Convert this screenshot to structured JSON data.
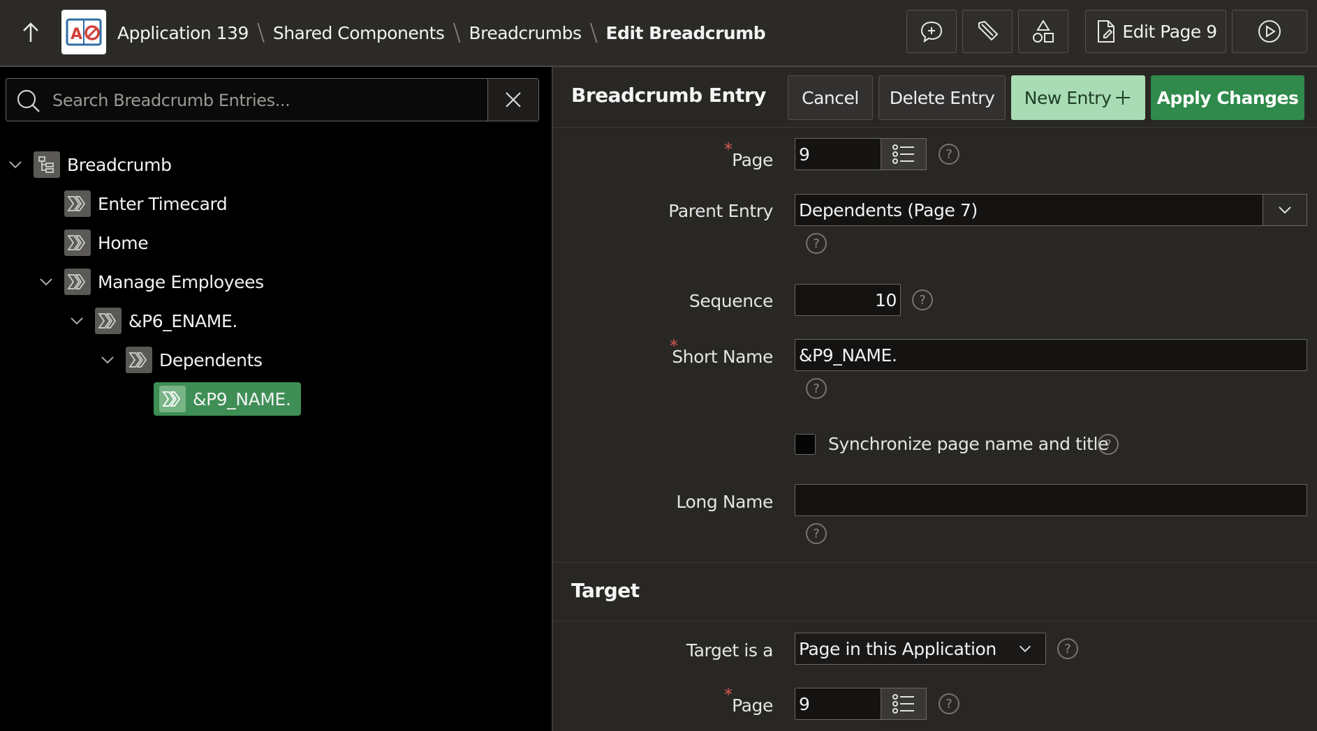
{
  "header": {
    "breadcrumbs": [
      "Application 139",
      "Shared Components",
      "Breadcrumbs",
      "Edit Breadcrumb"
    ],
    "separator": "\\",
    "edit_page_label": "Edit Page 9",
    "logo_text": "AO",
    "icons": [
      "arrow-up-icon",
      "feedback-icon",
      "edit-pencil-icon",
      "shared-components-icon",
      "page-icon",
      "run-play-icon"
    ]
  },
  "search": {
    "placeholder": "Search Breadcrumb Entries..."
  },
  "tree": {
    "items": [
      {
        "label": "Breadcrumb",
        "icon": "breadcrumb-tree-icon",
        "expanded": true
      },
      {
        "label": "Enter Timecard",
        "icon": "breadcrumb-entry-icon"
      },
      {
        "label": "Home",
        "icon": "breadcrumb-entry-icon"
      },
      {
        "label": "Manage Employees",
        "icon": "breadcrumb-entry-icon",
        "expanded": true
      },
      {
        "label": "&P6_ENAME.",
        "icon": "breadcrumb-entry-icon",
        "expanded": true
      },
      {
        "label": "Dependents",
        "icon": "breadcrumb-entry-icon",
        "expanded": true
      },
      {
        "label": "&P9_NAME.",
        "icon": "breadcrumb-entry-icon",
        "selected": true
      }
    ]
  },
  "panel": {
    "title": "Breadcrumb Entry",
    "buttons": {
      "cancel": "Cancel",
      "delete": "Delete Entry",
      "new_entry": "New Entry",
      "apply": "Apply Changes"
    }
  },
  "form": {
    "page": {
      "label": "Page",
      "value": "9",
      "required": true
    },
    "parent_entry": {
      "label": "Parent Entry",
      "value": "Dependents (Page 7)"
    },
    "sequence": {
      "label": "Sequence",
      "value": "10"
    },
    "short_name": {
      "label": "Short Name",
      "value": "&P9_NAME.",
      "required": true
    },
    "sync": {
      "label": "Synchronize page name and title",
      "checked": false
    },
    "long_name": {
      "label": "Long Name",
      "value": ""
    },
    "required_mark": "*",
    "help_glyph": "?"
  },
  "target": {
    "title": "Target",
    "target_is_a": {
      "label": "Target is a",
      "value": "Page in this Application"
    },
    "page": {
      "label": "Page",
      "value": "9",
      "required": true
    }
  },
  "colors": {
    "topbar": "#2c2a27",
    "panel_bg": "#292724",
    "left_bg": "#000000",
    "selected_green": "#3e8e55",
    "apply_green": "#2f8a4b",
    "new_entry_green": "#a9dcb5",
    "required_red": "#d45b4f"
  }
}
